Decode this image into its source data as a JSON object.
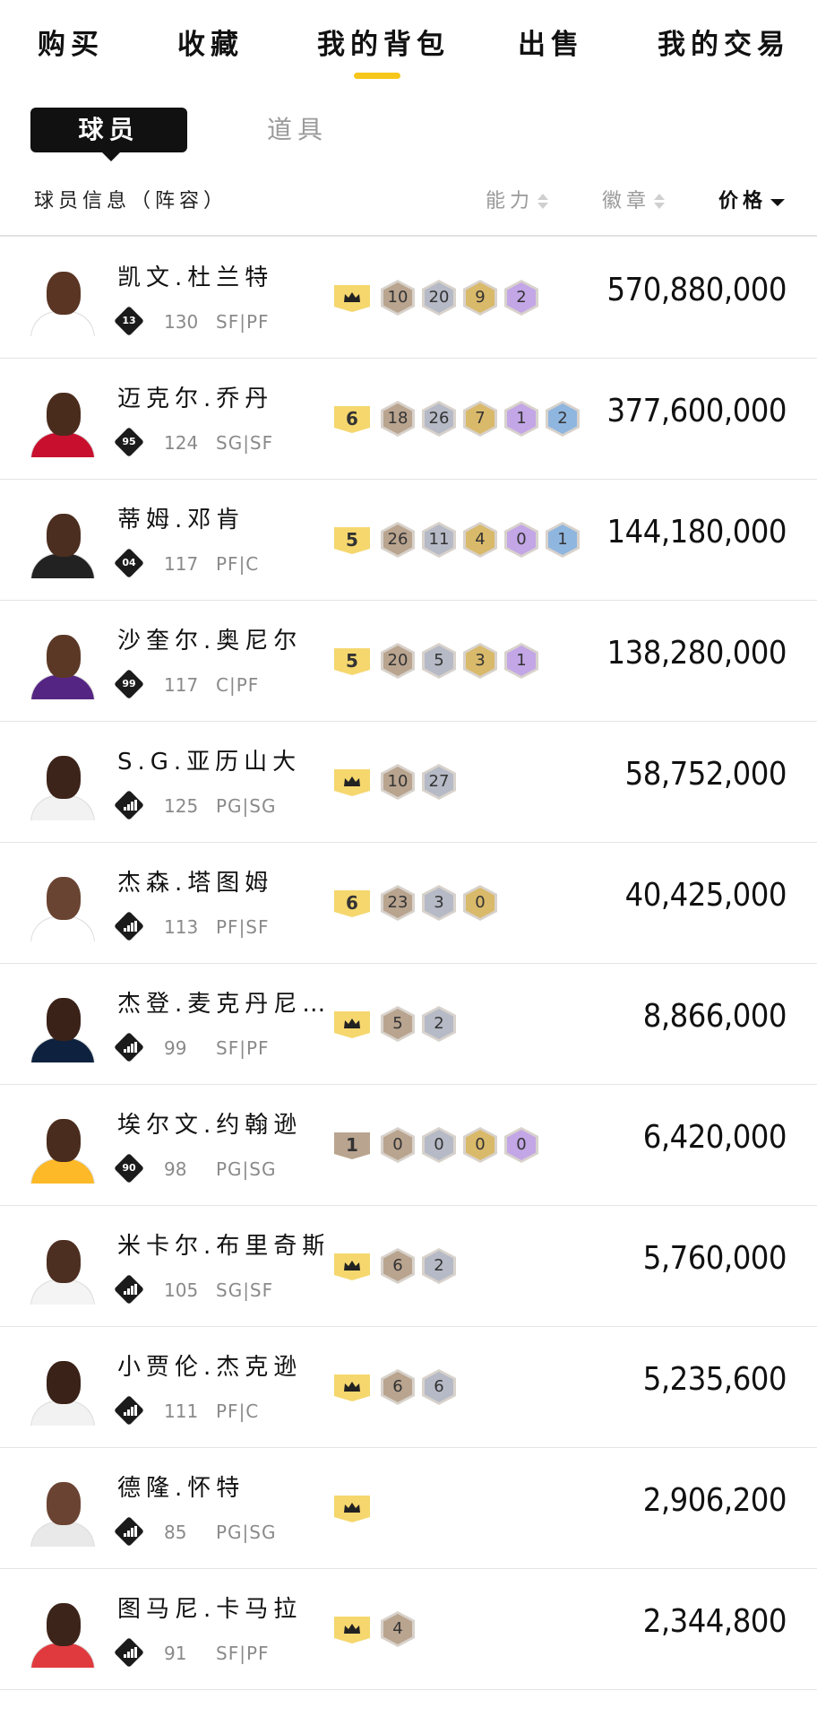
{
  "nav": {
    "tabs": [
      {
        "label": "购买"
      },
      {
        "label": "收藏"
      },
      {
        "label": "我的背包"
      },
      {
        "label": "出售"
      },
      {
        "label": "我的交易"
      }
    ],
    "active_index": 2,
    "accent_color": "#f7c61a"
  },
  "sub_tabs": {
    "active": "球员",
    "inactive": "道具"
  },
  "columns": {
    "info": "球员信息（阵容）",
    "ability": "能力",
    "badge": "徽章",
    "price": "价格",
    "sorted_by": "price",
    "sort_direction": "desc"
  },
  "players": [
    {
      "name": "凯文.杜兰特",
      "rating_badge": "13",
      "ovr": "130",
      "pos": "SF|PF",
      "level": "crown",
      "badges": [
        10,
        20,
        9,
        2
      ],
      "price": "570,880,000",
      "skin": "#5a3524",
      "jersey": "#ffffff"
    },
    {
      "name": "迈克尔.乔丹",
      "rating_badge": "95",
      "ovr": "124",
      "pos": "SG|SF",
      "level": "6",
      "badges": [
        18,
        26,
        7,
        1,
        2
      ],
      "price": "377,600,000",
      "skin": "#4a2c1d",
      "jersey": "#c8102e"
    },
    {
      "name": "蒂姆.邓肯",
      "rating_badge": "04",
      "ovr": "117",
      "pos": "PF|C",
      "level": "5",
      "badges": [
        26,
        11,
        4,
        0,
        1
      ],
      "price": "144,180,000",
      "skin": "#4b2e20",
      "jersey": "#222222"
    },
    {
      "name": "沙奎尔.奥尼尔",
      "rating_badge": "99",
      "ovr": "117",
      "pos": "C|PF",
      "level": "5",
      "badges": [
        20,
        5,
        3,
        1
      ],
      "price": "138,280,000",
      "skin": "#5b3826",
      "jersey": "#552583"
    },
    {
      "name": "S.G.亚历山大",
      "rating_badge": "bars",
      "ovr": "125",
      "pos": "PG|SG",
      "level": "crown",
      "badges": [
        10,
        27
      ],
      "price": "58,752,000",
      "skin": "#3d241a",
      "jersey": "#f2f2f2"
    },
    {
      "name": "杰森.塔图姆",
      "rating_badge": "bars",
      "ovr": "113",
      "pos": "PF|SF",
      "level": "6",
      "badges": [
        23,
        3,
        0
      ],
      "price": "40,425,000",
      "skin": "#6a4432",
      "jersey": "#ffffff"
    },
    {
      "name": "杰登.麦克丹尼…",
      "rating_badge": "bars",
      "ovr": "99",
      "pos": "SF|PF",
      "level": "crown",
      "badges": [
        5,
        2
      ],
      "price": "8,866,000",
      "skin": "#3a2219",
      "jersey": "#0e2240"
    },
    {
      "name": "埃尔文.约翰逊",
      "rating_badge": "90",
      "ovr": "98",
      "pos": "PG|SG",
      "level": "1",
      "badges": [
        0,
        0,
        0,
        0
      ],
      "price": "6,420,000",
      "skin": "#4a2c1e",
      "jersey": "#fdb927"
    },
    {
      "name": "米卡尔.布里奇斯",
      "rating_badge": "bars",
      "ovr": "105",
      "pos": "SG|SF",
      "level": "crown",
      "badges": [
        6,
        2
      ],
      "price": "5,760,000",
      "skin": "#4d2f22",
      "jersey": "#f4f4f4"
    },
    {
      "name": "小贾伦.杰克逊",
      "rating_badge": "bars",
      "ovr": "111",
      "pos": "PF|C",
      "level": "crown",
      "badges": [
        6,
        6
      ],
      "price": "5,235,600",
      "skin": "#3a2219",
      "jersey": "#f2f2f2"
    },
    {
      "name": "德隆.怀特",
      "rating_badge": "bars",
      "ovr": "85",
      "pos": "PG|SG",
      "level": "crown",
      "badges": [],
      "price": "2,906,200",
      "skin": "#6b4332",
      "jersey": "#e9e9e9"
    },
    {
      "name": "图马尼.卡马拉",
      "rating_badge": "bars",
      "ovr": "91",
      "pos": "SF|PF",
      "level": "crown",
      "badges": [
        4
      ],
      "price": "2,344,800",
      "skin": "#3d241a",
      "jersey": "#e03a3e"
    }
  ],
  "badge_colors": [
    "#b9a48f",
    "#b6bac6",
    "#d9b96a",
    "#c3a6e6",
    "#8fb6df"
  ],
  "level_colors": {
    "crown": "#f5d76e",
    "6": "#f5d76e",
    "5": "#f5d76e",
    "1": "#b9a48f"
  }
}
